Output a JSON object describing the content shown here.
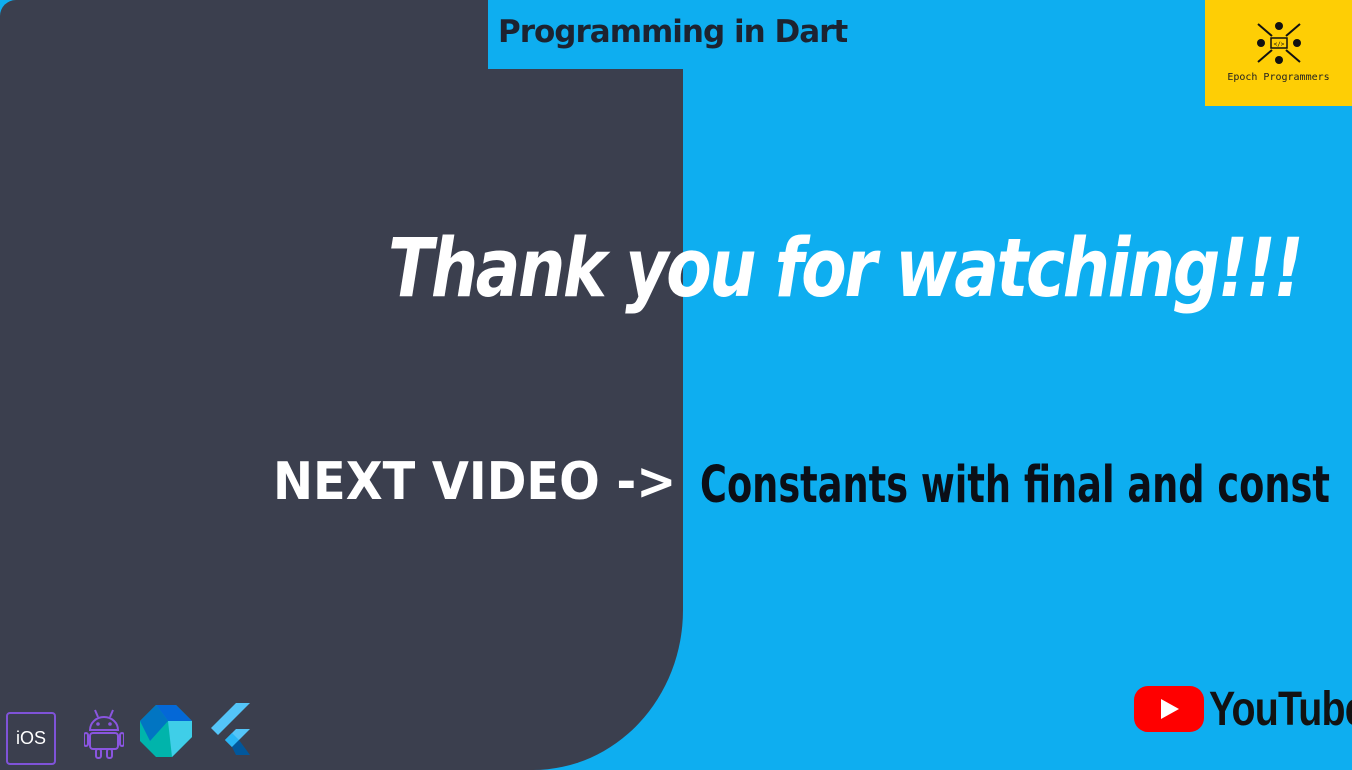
{
  "header": {
    "title": "Programming in Dart"
  },
  "brand": {
    "logo_text": "Epoch Programmers",
    "logo_bg": "#fece05"
  },
  "main": {
    "thanks": "Thank you for watching!!!",
    "next_label": "NEXT VIDEO ->",
    "next_title": "Constants with final and const"
  },
  "footer": {
    "platform_icons": [
      "ios-icon",
      "android-icon",
      "dart-icon",
      "flutter-icon"
    ],
    "ios_label": "iOS",
    "youtube_text": "YouTube"
  },
  "colors": {
    "background": "#0eaef0",
    "panel": "#3b3f4e",
    "youtube_red": "#ff0000"
  }
}
